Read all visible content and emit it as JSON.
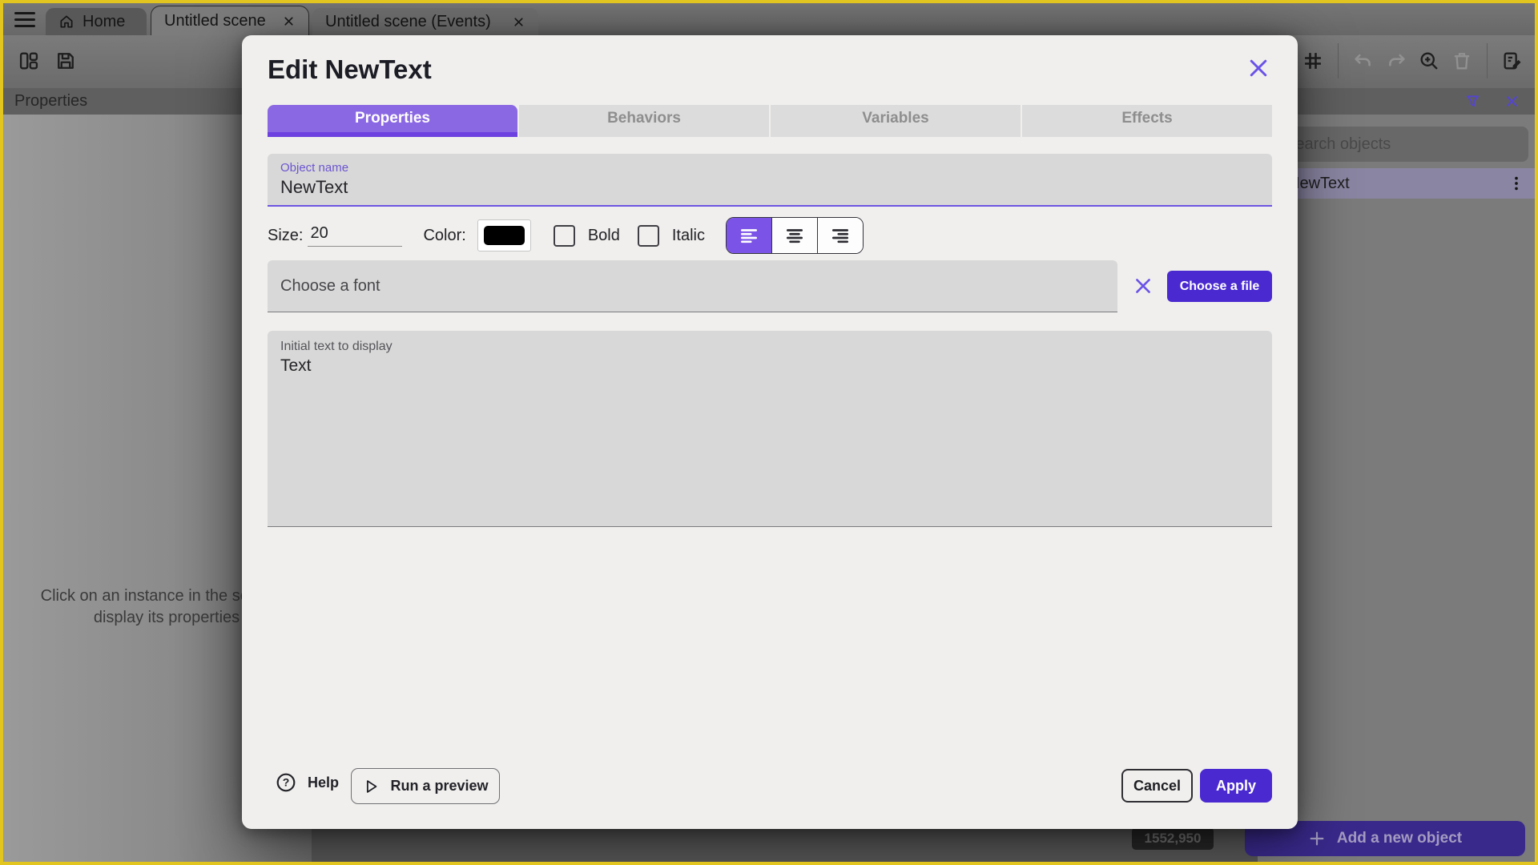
{
  "window_tabs": {
    "home": "Home",
    "scene": "Untitled scene",
    "events": "Untitled scene (Events)"
  },
  "left_panel": {
    "header": "Properties",
    "empty_message": "Click on an instance in the scene to display its properties"
  },
  "canvas": {
    "coordinates": "1552,950"
  },
  "objects_panel": {
    "search_placeholder": "Search objects",
    "item_name": "NewText",
    "add_button_label": "Add a new object"
  },
  "modal": {
    "title": "Edit NewText",
    "tabs": [
      {
        "label": "Properties"
      },
      {
        "label": "Behaviors"
      },
      {
        "label": "Variables"
      },
      {
        "label": "Effects"
      }
    ],
    "active_tab": "Properties",
    "object_name": {
      "label": "Object name",
      "value": "NewText"
    },
    "size": {
      "label": "Size:",
      "value": "20"
    },
    "color": {
      "label": "Color:",
      "value": "#000000"
    },
    "bold_label": "Bold",
    "bold_checked": false,
    "italic_label": "Italic",
    "italic_checked": false,
    "alignment": "left",
    "font_field": {
      "placeholder": "Choose a font",
      "choose_file_label": "Choose a file"
    },
    "initial_text": {
      "label": "Initial text to display",
      "value": "Text"
    },
    "footer": {
      "help_label": "Help",
      "run_preview_label": "Run a preview",
      "cancel_label": "Cancel",
      "apply_label": "Apply"
    }
  },
  "colors": {
    "window_border": "#e2c51f",
    "tab_active_bg": "#8b68e3",
    "tab_active_underline": "#6c41df",
    "primary_button": "#4a2ad0",
    "accent_purple": "#6b52e8",
    "text_color_swatch": "#000000"
  }
}
